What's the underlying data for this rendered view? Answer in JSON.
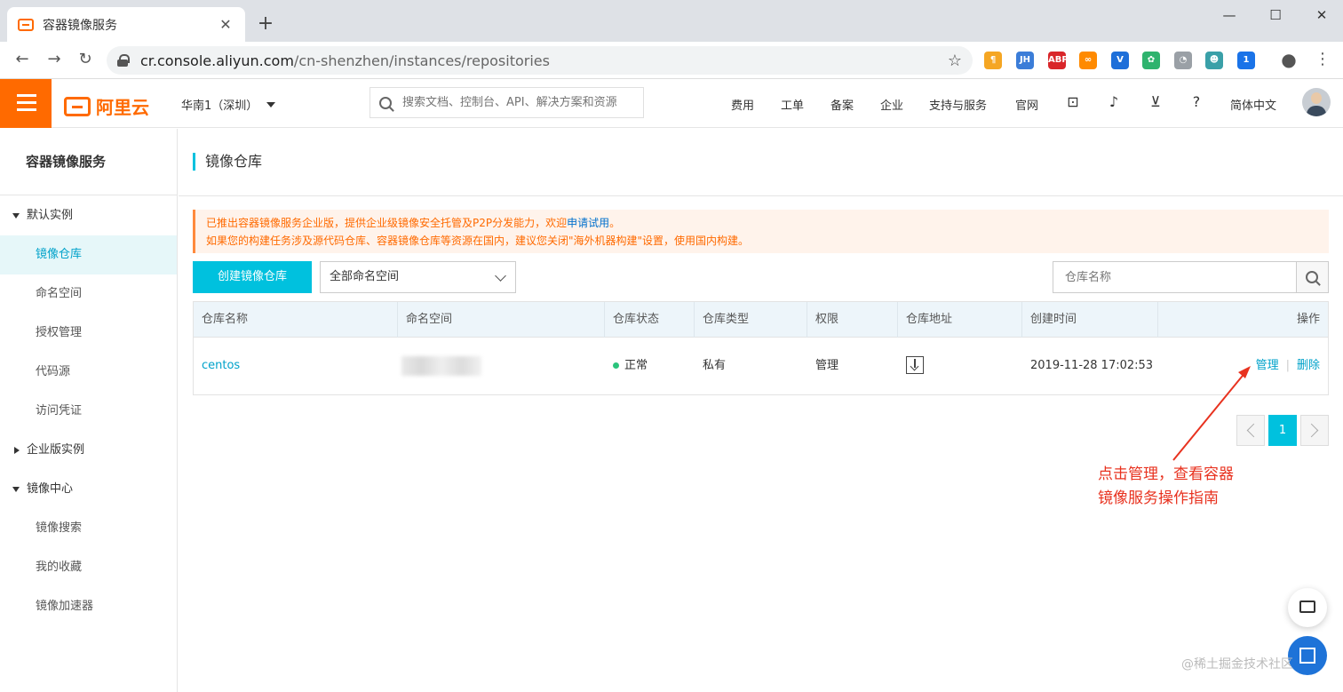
{
  "browser": {
    "tab_title": "容器镜像服务",
    "tab_close": "✕",
    "new_tab": "+",
    "window_controls": [
      "—",
      "☐",
      "✕"
    ],
    "url_host": "cr.console.aliyun.com",
    "url_path": "/cn-shenzhen/instances/repositories",
    "extensions": [
      {
        "name": "paragraph-extension-icon",
        "label": "¶",
        "color": "#f5a623"
      },
      {
        "name": "jh-extension-icon",
        "label": "JH",
        "color": "#3b7dd8"
      },
      {
        "name": "abp-extension-icon",
        "label": "ABP",
        "color": "#d9262a"
      },
      {
        "name": "infinity-extension-icon",
        "label": "∞",
        "color": "#ff8a00"
      },
      {
        "name": "v-extension-icon",
        "label": "V",
        "color": "#1e6fd9"
      },
      {
        "name": "green-extension-icon",
        "label": "✿",
        "color": "#2fb36e"
      },
      {
        "name": "speed-extension-icon",
        "label": "◔",
        "color": "#9aa0a6"
      },
      {
        "name": "owl-extension-icon",
        "label": "☻",
        "color": "#3aa0a8"
      },
      {
        "name": "badge-extension-icon",
        "label": "1",
        "color": "#1a73e8"
      }
    ]
  },
  "topbar": {
    "logo_text": "阿里云",
    "region": "华南1（深圳）",
    "search_placeholder": "搜索文档、控制台、API、解决方案和资源",
    "links": [
      "费用",
      "工单",
      "备案",
      "企业",
      "支持与服务",
      "官网"
    ],
    "language": "简体中文"
  },
  "sidebar": {
    "title": "容器镜像服务",
    "groups": [
      {
        "label": "默认实例",
        "expanded": true,
        "items": [
          "镜像仓库",
          "命名空间",
          "授权管理",
          "代码源",
          "访问凭证"
        ]
      },
      {
        "label": "企业版实例",
        "expanded": false,
        "items": []
      },
      {
        "label": "镜像中心",
        "expanded": true,
        "items": [
          "镜像搜索",
          "我的收藏",
          "镜像加速器"
        ]
      }
    ],
    "active_item": "镜像仓库"
  },
  "main": {
    "title": "镜像仓库",
    "notice_line1_prefix": "已推出容器镜像服务企业版，提供企业级镜像安全托管及P2P分发能力，欢迎",
    "notice_link": "申请试用",
    "notice_line1_suffix": "。",
    "notice_line2": "如果您的构建任务涉及源代码仓库、容器镜像仓库等资源在国内，建议您关闭\"海外机器构建\"设置，使用国内构建。",
    "create_button": "创建镜像仓库",
    "namespace_select": "全部命名空间",
    "repo_search_placeholder": "仓库名称",
    "columns": [
      "仓库名称",
      "命名空间",
      "仓库状态",
      "仓库类型",
      "权限",
      "仓库地址",
      "创建时间",
      "操作"
    ],
    "rows": [
      {
        "name": "centos",
        "namespace": "",
        "status": "正常",
        "type": "私有",
        "permission": "管理",
        "created": "2019-11-28 17:02:53",
        "action_manage": "管理",
        "action_delete": "删除"
      }
    ],
    "separator": "|",
    "page_current": "1"
  },
  "annotation": {
    "line1": "点击管理，查看容器",
    "line2": "镜像服务操作指南",
    "color": "#e8321f"
  },
  "watermark": "@稀土掘金技术社区"
}
